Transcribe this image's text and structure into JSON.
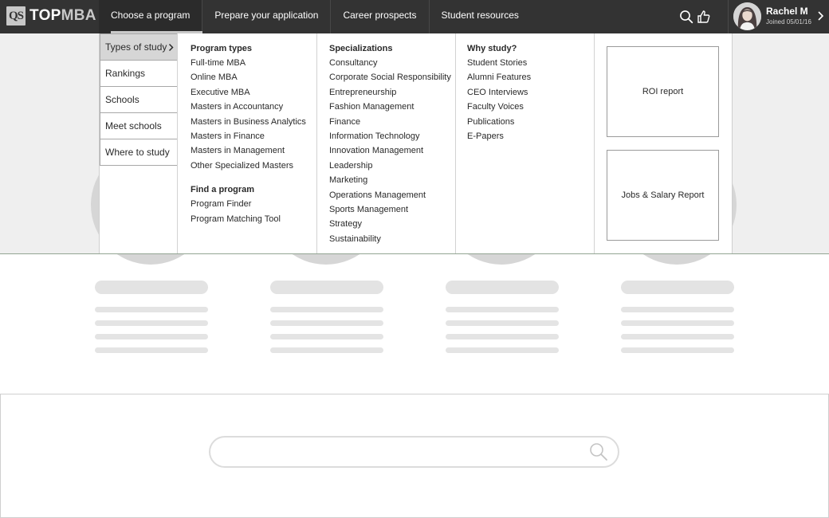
{
  "brand": {
    "logo_mark": "QS",
    "logo_top": "TOP",
    "logo_mba": "MBA"
  },
  "nav": {
    "items": [
      {
        "label": "Choose a program"
      },
      {
        "label": "Prepare your application"
      },
      {
        "label": "Career prospects"
      },
      {
        "label": "Student resources"
      }
    ],
    "active": "Choose a program"
  },
  "header_icons": [
    "search-icon",
    "thumbs-up-icon"
  ],
  "user": {
    "name": "Rachel M",
    "joined": "Joined 05/01/16"
  },
  "menu": {
    "side_items": [
      {
        "label": "Types of study"
      },
      {
        "label": "Rankings"
      },
      {
        "label": "Schools"
      },
      {
        "label": "Meet schools"
      },
      {
        "label": "Where to study"
      }
    ],
    "program_types": {
      "heading": "Program types",
      "links": [
        "Full-time MBA",
        "Online MBA",
        "Executive MBA",
        "Masters in Accountancy",
        "Masters in Business Analytics",
        "Masters in Finance",
        "Masters in Management",
        "Other Specialized Masters"
      ]
    },
    "find_program": {
      "heading": "Find a program",
      "links": [
        "Program Finder",
        "Program Matching Tool"
      ]
    },
    "specializations": {
      "heading": "Specializations",
      "links": [
        "Consultancy",
        "Corporate Social Responsibility",
        "Entrepreneurship",
        "Fashion Management",
        "Finance",
        "Information Technology",
        "Innovation Management",
        "Leadership",
        "Marketing",
        "Operations Management",
        "Sports Management",
        "Strategy",
        "Sustainability"
      ]
    },
    "why_study": {
      "heading": "Why study?",
      "links": [
        "Student Stories",
        "Alumni Features",
        "CEO Interviews",
        "Faculty Voices",
        "Publications",
        "E-Papers"
      ]
    },
    "reports": [
      "ROI report",
      "Jobs & Salary Report"
    ]
  },
  "search": {
    "placeholder": "",
    "value": ""
  },
  "colors": {
    "topbar": "#333333",
    "active_underline": "#c9c9c9",
    "placeholder": "#e3e3e3"
  }
}
